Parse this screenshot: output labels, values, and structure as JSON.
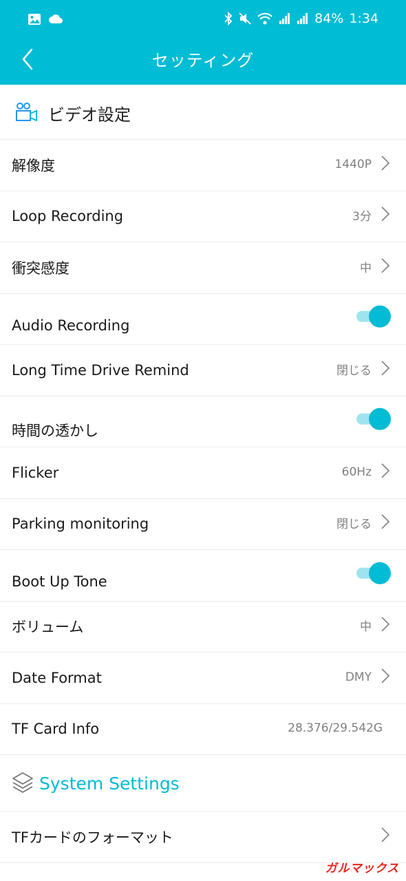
{
  "status": {
    "battery": "84%",
    "time": "1:34"
  },
  "nav": {
    "title": "セッティング"
  },
  "video_section": {
    "title": "ビデオ設定",
    "rows": [
      {
        "label": "解像度",
        "value": "1440P"
      },
      {
        "label": "Loop Recording",
        "value": "3分"
      },
      {
        "label": "衝突感度",
        "value": "中"
      },
      {
        "label": "Audio Recording",
        "toggle": true
      },
      {
        "label": "Long Time Drive Remind",
        "value": "閉じる"
      },
      {
        "label": "時間の透かし",
        "toggle": true
      },
      {
        "label": "Flicker",
        "value": "60Hz"
      },
      {
        "label": "Parking monitoring",
        "value": "閉じる"
      },
      {
        "label": "Boot Up Tone",
        "toggle": true
      },
      {
        "label": "ボリューム",
        "value": "中"
      },
      {
        "label": "Date Format",
        "value": "DMY"
      },
      {
        "label": "TF Card Info",
        "value": "28.376/29.542G"
      }
    ]
  },
  "system_section": {
    "title": "System Settings",
    "rows": [
      {
        "label": "TFカードのフォーマット"
      }
    ]
  },
  "watermark": "ガルマックス",
  "colors": {
    "accent": "#00bcd4",
    "toggle_track": "#9ee4ee",
    "divider": "#ececec",
    "value_text": "#808080"
  }
}
